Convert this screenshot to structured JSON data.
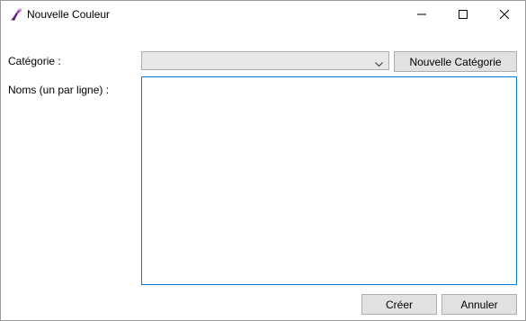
{
  "window": {
    "title": "Nouvelle Couleur",
    "icon": "paint-palette-icon",
    "controls": {
      "minimize_icon": "minimize-icon",
      "maximize_icon": "maximize-icon",
      "close_icon": "close-icon"
    }
  },
  "form": {
    "category_label": "Catégorie :",
    "category_value": "",
    "new_category_label": "Nouvelle Catégorie",
    "names_label": "Noms (un par ligne) :",
    "names_value": ""
  },
  "footer": {
    "create_label": "Créer",
    "cancel_label": "Annuler"
  },
  "colors": {
    "accent_border": "#0078d7",
    "button_bg": "#e1e1e1",
    "button_border": "#adadad"
  }
}
